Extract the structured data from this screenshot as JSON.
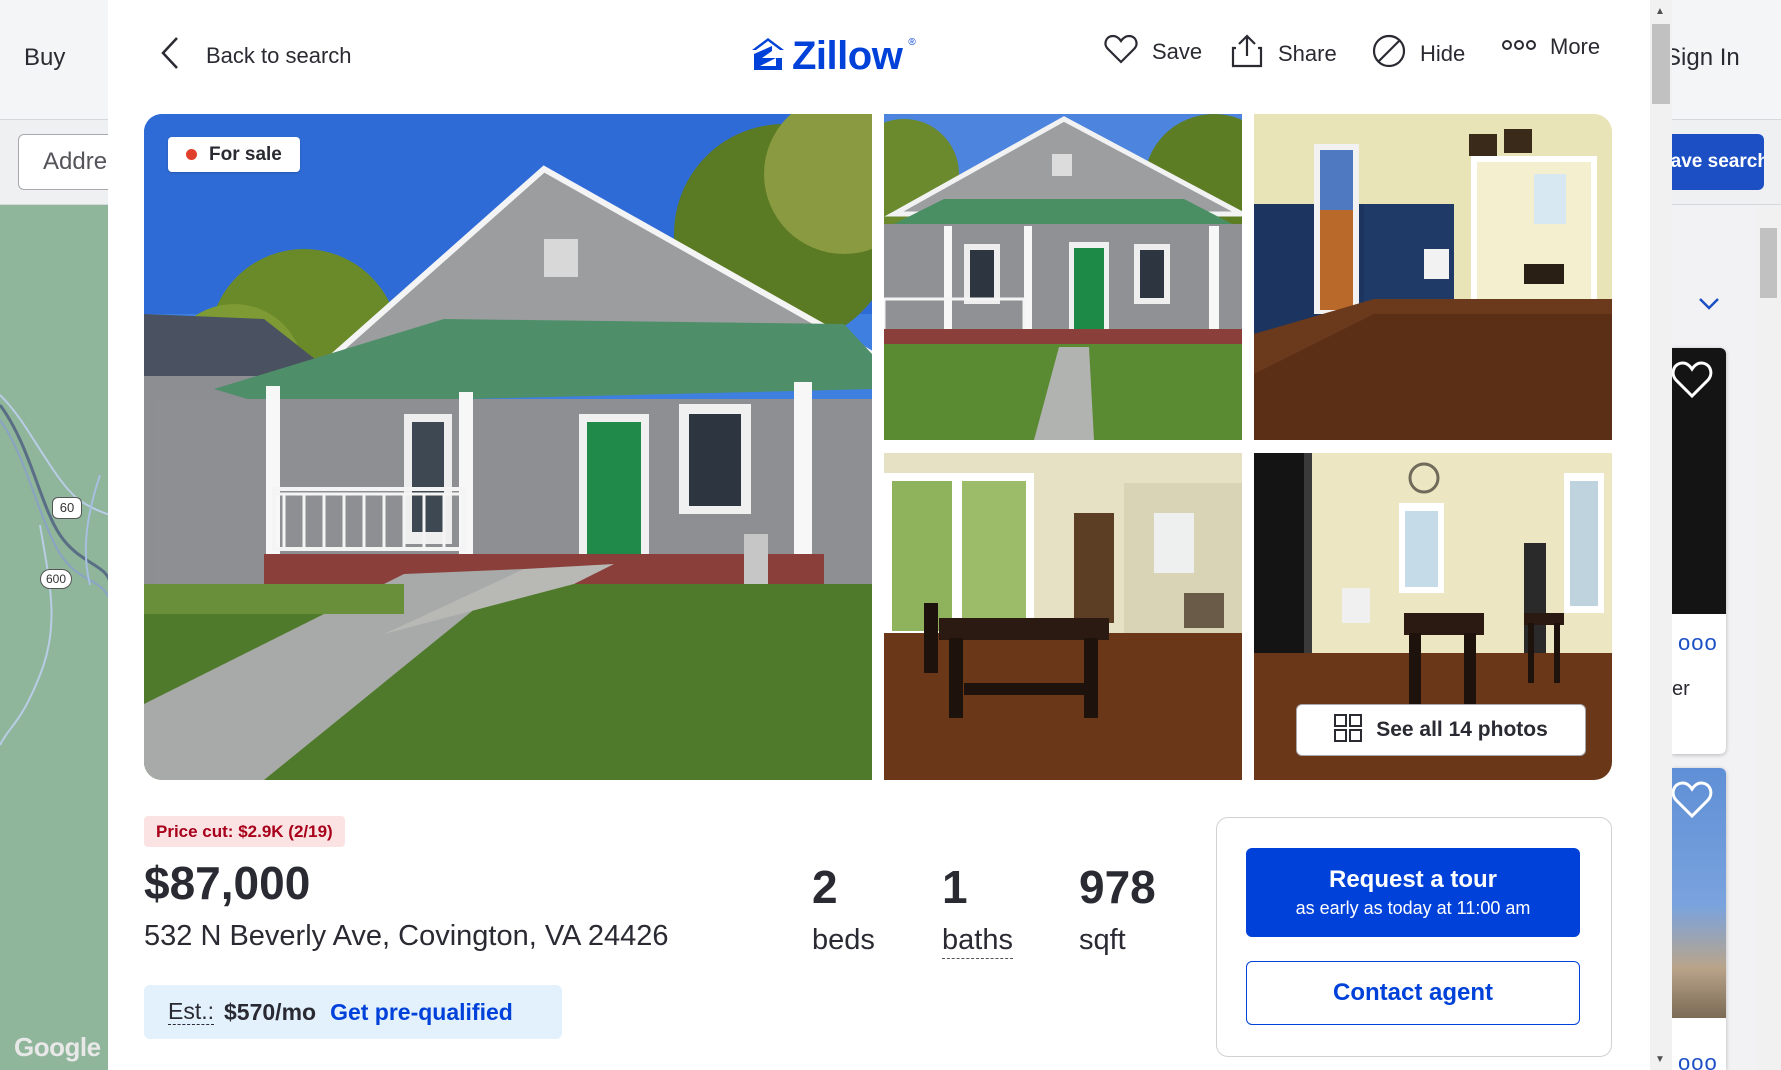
{
  "background": {
    "nav_buy": "Buy",
    "nav_sign_in": "Sign In",
    "address_placeholder": "Address",
    "save_search_label": "Save search",
    "sort_label": "u",
    "map_shields": [
      "60",
      "600"
    ],
    "google_label": "Google",
    "card_more_label": "ooo",
    "card_text": "er"
  },
  "nav": {
    "back_label": "Back to search",
    "logo_text": "Zillow",
    "logo_reg": "®",
    "actions": {
      "save": "Save",
      "share": "Share",
      "hide": "Hide",
      "more": "More"
    }
  },
  "gallery": {
    "status_badge": "For sale",
    "see_all_label": "See all 14 photos",
    "photo_count": 14
  },
  "listing": {
    "price_cut": "Price cut: $2.9K (2/19)",
    "price": "$87,000",
    "address": "532 N Beverly Ave, Covington, VA 24426",
    "stats": [
      {
        "value": "2",
        "label": "beds"
      },
      {
        "value": "1",
        "label": "baths"
      },
      {
        "value": "978",
        "label": "sqft"
      }
    ],
    "estimate": {
      "label": "Est.:",
      "value": "$570/mo",
      "link": "Get pre-qualified"
    }
  },
  "cta": {
    "tour_title": "Request a tour",
    "tour_subtitle": "as early as today at 11:00 am",
    "contact_label": "Contact agent"
  },
  "colors": {
    "brand_blue": "#0041d9",
    "price_cut_red": "#a8001a",
    "price_cut_bg": "#fbe3e3",
    "estimate_bg": "#e3f1fd",
    "status_dot": "#e0402b"
  }
}
